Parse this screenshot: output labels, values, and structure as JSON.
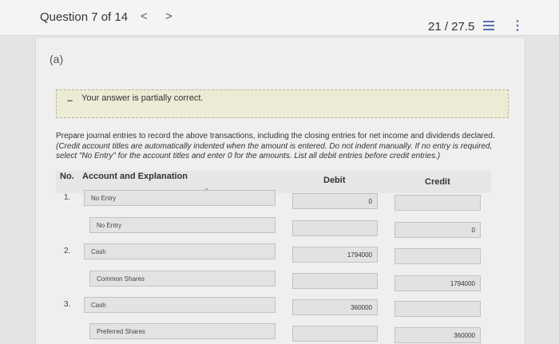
{
  "header": {
    "question_label": "Question 7 of 14",
    "prev_glyph": "<",
    "next_glyph": ">",
    "score": "21 / 27.5",
    "more_glyph": "⋮"
  },
  "part": {
    "label": "(a)"
  },
  "feedback": {
    "icon_glyph": "–",
    "text": "Your answer is partially correct."
  },
  "instructions": {
    "main": "Prepare journal entries to record the above transactions, including the closing entries for net income and dividends declared.",
    "italic": "(Credit account titles are automatically indented when the amount is entered. Do not indent manually. If no entry is required, select \"No Entry\" for the account titles and enter 0 for the amounts. List all debit entries before credit entries.)"
  },
  "table": {
    "col_no": "No.",
    "col_account": "Account and Explanation",
    "col_debit": "Debit",
    "col_credit": "Credit",
    "rows": [
      {
        "num": "1.",
        "account": "No Entry",
        "debit": "0",
        "credit": ""
      },
      {
        "num": "",
        "account": "No Entry",
        "debit": "",
        "credit": "0"
      },
      {
        "num": "2.",
        "account": "Cash",
        "debit": "1794000",
        "credit": ""
      },
      {
        "num": "",
        "account": "Common Shares",
        "debit": "",
        "credit": "1794000"
      },
      {
        "num": "3.",
        "account": "Cash",
        "debit": "360000",
        "credit": ""
      },
      {
        "num": "",
        "account": "Preferred Shares",
        "debit": "",
        "credit": "360000"
      }
    ]
  }
}
